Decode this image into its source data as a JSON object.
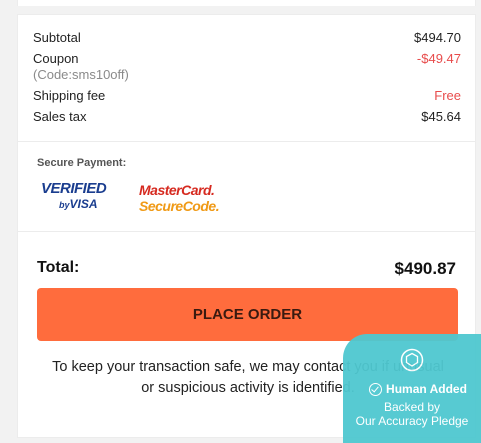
{
  "summary": {
    "subtotal_label": "Subtotal",
    "subtotal_value": "$494.70",
    "coupon_label": "Coupon",
    "coupon_code": "(Code:sms10off)",
    "coupon_value": "-$49.47",
    "shipping_label": "Shipping fee",
    "shipping_value": "Free",
    "tax_label": "Sales tax",
    "tax_value": "$45.64"
  },
  "payment": {
    "title": "Secure Payment:",
    "visa_logo_text": "VERIFIED by VISA",
    "mastercard_logo_text": "MasterCard. SecureCode."
  },
  "total": {
    "label": "Total:",
    "value": "$490.87"
  },
  "place_order_label": "PLACE ORDER",
  "safe_note": "To keep your transaction safe, we may contact you if unusual or suspicious activity is identified.",
  "pledge": {
    "title": "Human Added",
    "line1": "Backed by",
    "line2": "Our Accuracy Pledge"
  },
  "colors": {
    "accent": "#ff6c3d",
    "discount": "#e84c4c",
    "pledge": "#4fc8d0"
  }
}
